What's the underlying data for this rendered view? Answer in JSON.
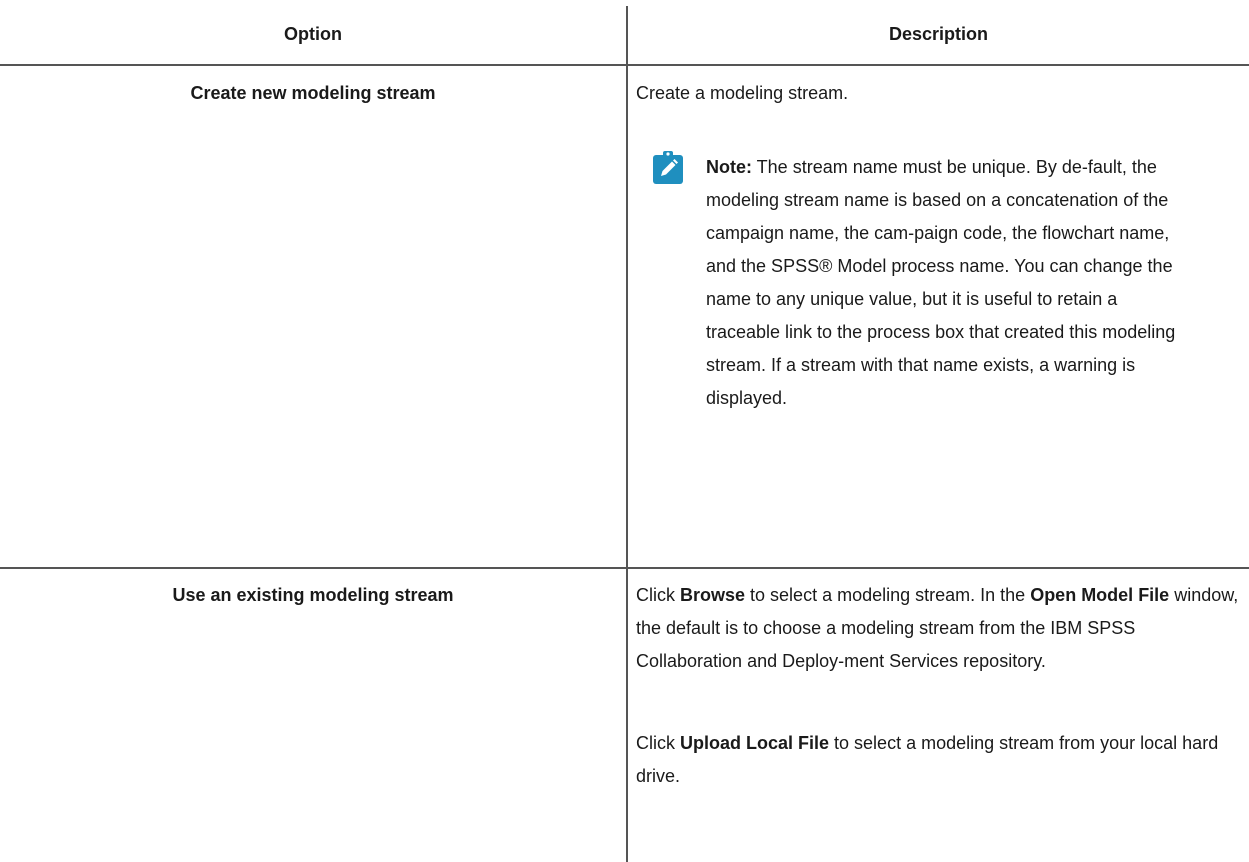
{
  "table": {
    "headers": {
      "option": "Option",
      "description": "Description"
    },
    "rows": [
      {
        "option": "Create new modeling stream",
        "description": "Create a modeling stream.",
        "note": {
          "label": "Note:",
          "text": " The stream name must be unique. By de-fault, the modeling stream name is based on a concatenation of the campaign name, the cam-paign code, the flowchart name, and the SPSS® Model process name. You can change the name to any unique value, but it is useful to retain a traceable link to the process box that created this modeling stream. If a stream with that name exists, a warning is displayed.",
          "icon": "pencil-note-icon",
          "icon_color": "#1f8fbf"
        }
      },
      {
        "option": "Use an existing modeling stream",
        "paragraphs": [
          {
            "pre": "Click ",
            "bold1": "Browse",
            "mid": " to select a modeling stream. In the ",
            "bold2": "Open Model File",
            "post": " window, the default is to choose a modeling stream from the IBM SPSS Collaboration and Deploy-ment Services repository."
          },
          {
            "pre": "Click ",
            "bold1": "Upload Local File",
            "post": " to select a modeling stream from your local hard drive."
          }
        ]
      }
    ]
  }
}
